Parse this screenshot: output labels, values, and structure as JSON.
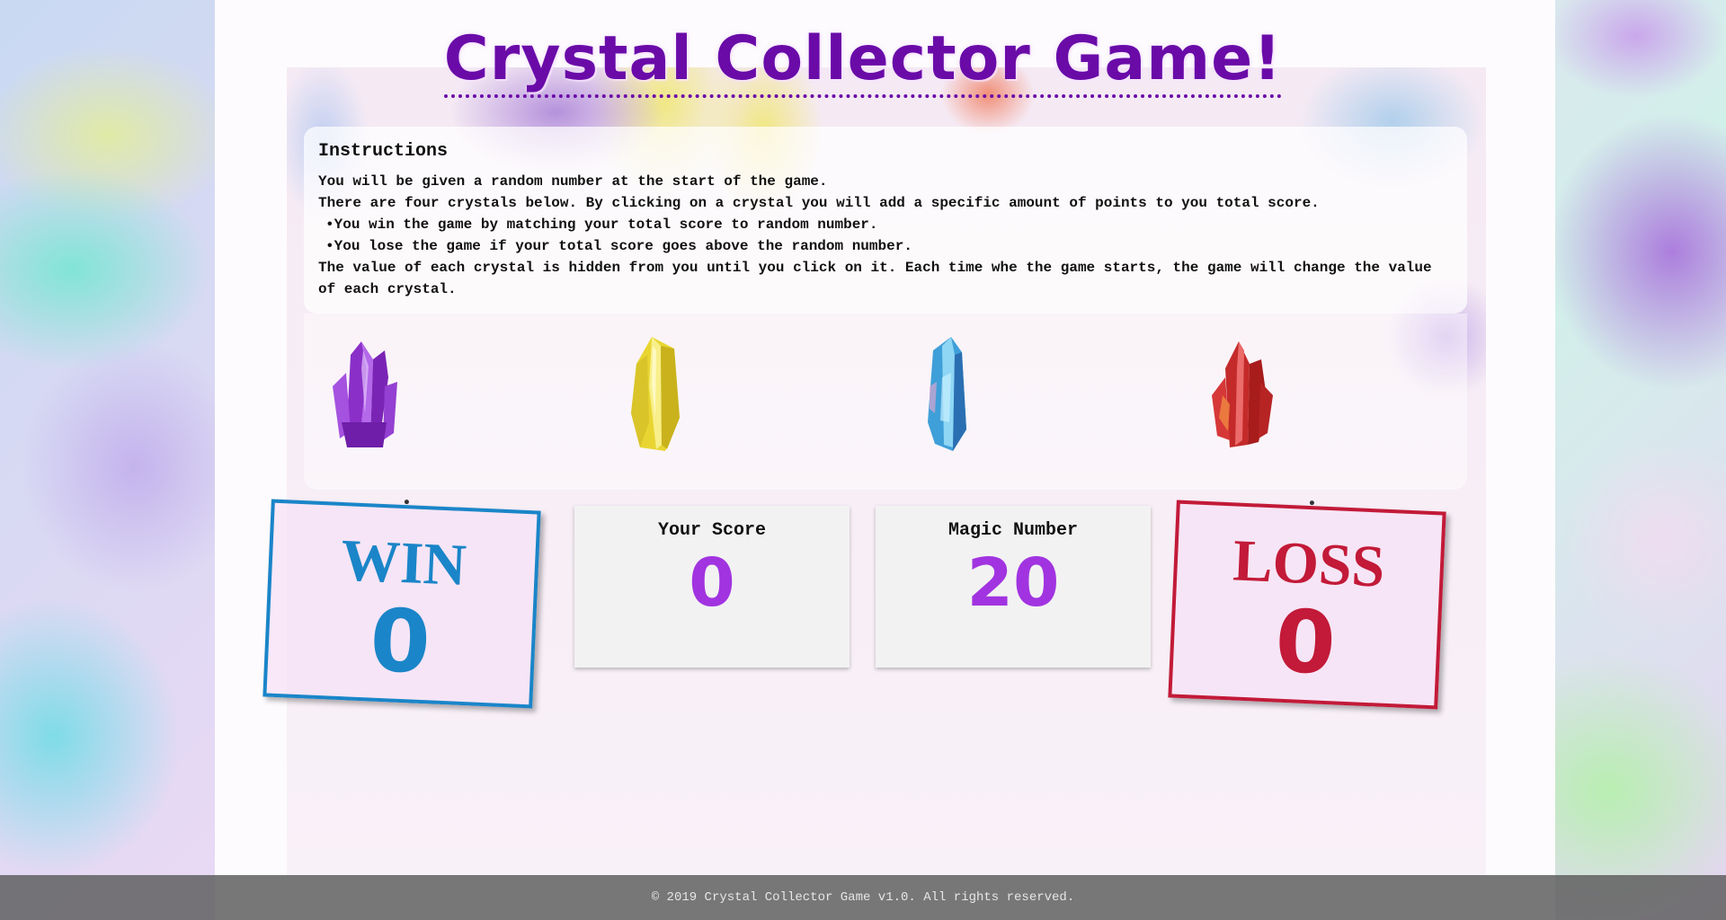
{
  "title": "Crystal Collector Game!",
  "instructions": {
    "heading": "Instructions",
    "lines": [
      "You will be given a random number at the start of the game.",
      "There are four crystals below. By clicking on a crystal you will add a specific amount of points to you total score.",
      "You win the game by matching your total score to random number.",
      "You lose the game if your total score goes above the random number.",
      "The value of each crystal is hidden from you until you click on it. Each time whe the game starts, the game will change the value of each crystal."
    ]
  },
  "crystals": [
    {
      "name": "purple",
      "color": "#9b3fd6"
    },
    {
      "name": "yellow",
      "color": "#e6d634"
    },
    {
      "name": "blue",
      "color": "#3f9fd8"
    },
    {
      "name": "red",
      "color": "#c42a2a"
    }
  ],
  "win": {
    "label": "WIN",
    "value": "0",
    "color": "#1a85c8"
  },
  "loss": {
    "label": "LOSS",
    "value": "0",
    "color": "#c21a38"
  },
  "score": {
    "label": "Your Score",
    "value": "0"
  },
  "magic": {
    "label": "Magic Number",
    "value": "20"
  },
  "footer": "© 2019 Crystal Collector Game v1.0. All rights reserved."
}
